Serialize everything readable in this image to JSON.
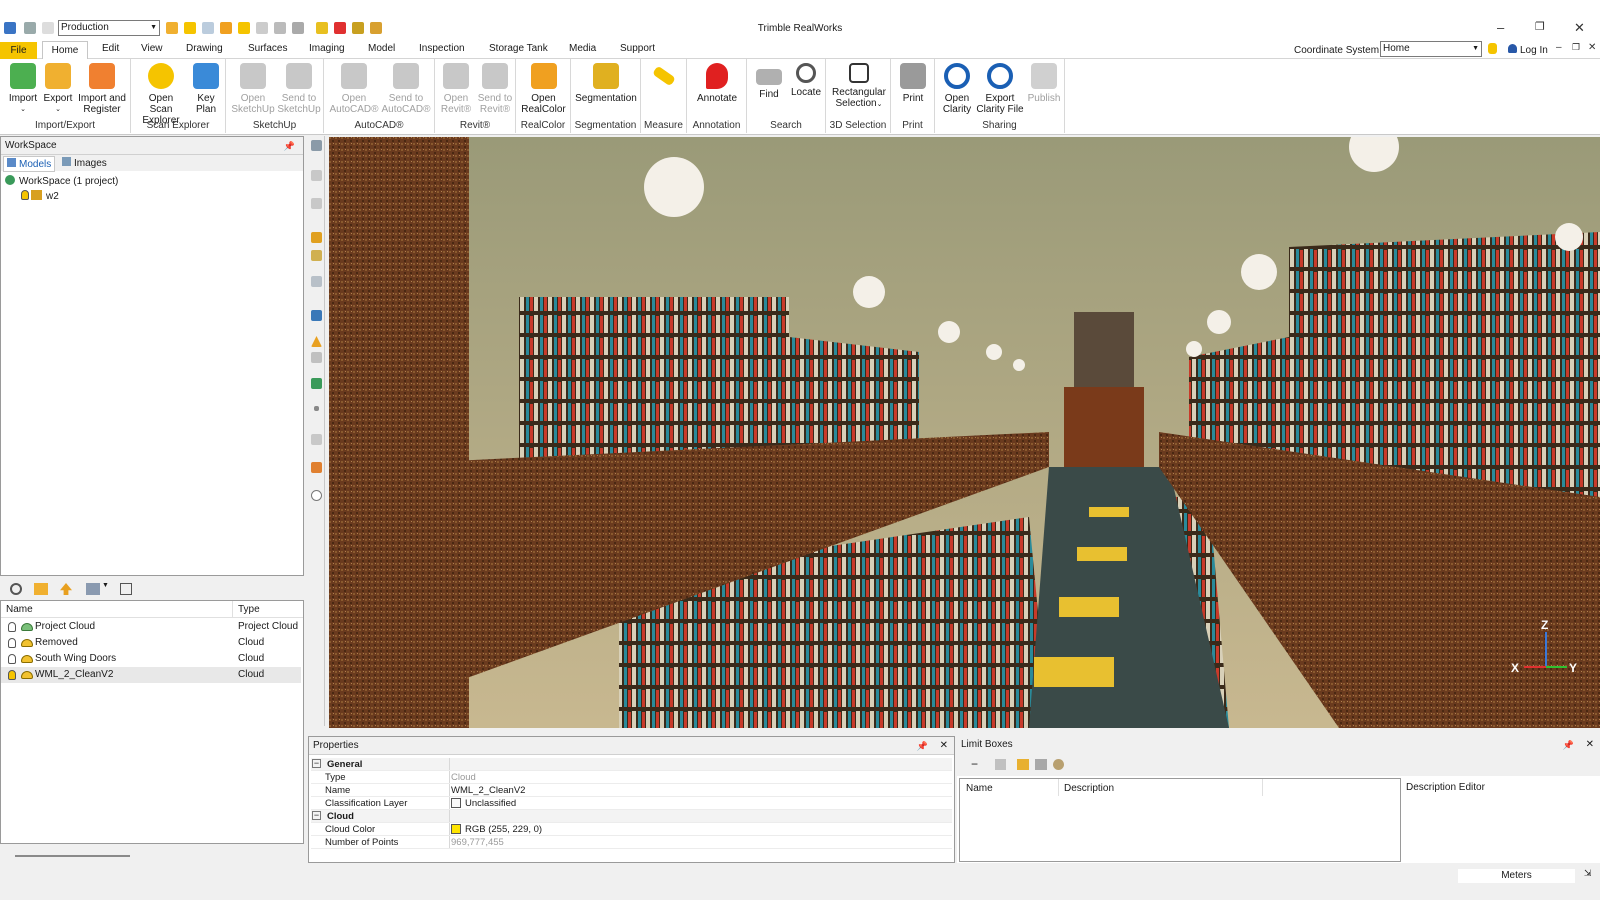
{
  "window": {
    "title": "Trimble RealWorks",
    "profile": "Production"
  },
  "menu": {
    "tabs": [
      "File",
      "Home",
      "Edit",
      "View",
      "Drawing",
      "Surfaces",
      "Imaging",
      "Model",
      "Inspection",
      "Storage Tank",
      "Media",
      "Support"
    ],
    "coordinate_label": "Coordinate System",
    "coordinate_value": "Home",
    "login": "Log In"
  },
  "ribbon": {
    "import_export": {
      "label": "Import/Export",
      "import": "Import",
      "export": "Export",
      "import_register_1": "Import and",
      "import_register_2": "Register"
    },
    "scan_explorer": {
      "label": "Scan Explorer",
      "open_scan_1": "Open Scan",
      "open_scan_2": "Explorer",
      "key_plan_1": "Key",
      "key_plan_2": "Plan"
    },
    "sketchup": {
      "label": "SketchUp",
      "open_1": "Open",
      "open_2": "SketchUp",
      "send_1": "Send to",
      "send_2": "SketchUp"
    },
    "autocad": {
      "label": "AutoCAD®",
      "open_1": "Open",
      "open_2": "AutoCAD®",
      "send_1": "Send to",
      "send_2": "AutoCAD®"
    },
    "revit": {
      "label": "Revit®",
      "open_1": "Open",
      "open_2": "Revit®",
      "send_1": "Send to",
      "send_2": "Revit®"
    },
    "realcolor": {
      "label": "RealColor",
      "open_1": "Open",
      "open_2": "RealColor"
    },
    "segmentation": {
      "label": "Segmentation",
      "btn": "Segmentation"
    },
    "measure": {
      "label": "Measure"
    },
    "annotation": {
      "label": "Annotation",
      "btn": "Annotate"
    },
    "search": {
      "label": "Search",
      "find": "Find",
      "locate": "Locate"
    },
    "selection": {
      "label": "3D Selection",
      "btn_1": "Rectangular",
      "btn_2": "Selection"
    },
    "print": {
      "label": "Print",
      "btn": "Print"
    },
    "sharing": {
      "label": "Sharing",
      "open_1": "Open",
      "open_2": "Clarity",
      "export_1": "Export",
      "export_2": "Clarity File",
      "publish": "Publish"
    }
  },
  "workspace": {
    "title": "WorkSpace",
    "tabs": [
      "Models",
      "Images"
    ],
    "root": "WorkSpace  (1 project)",
    "child": "w2"
  },
  "model_list": {
    "col_name": "Name",
    "col_type": "Type",
    "rows": [
      {
        "name": "Project Cloud",
        "type": "Project Cloud"
      },
      {
        "name": "Removed",
        "type": "Cloud"
      },
      {
        "name": "South Wing Doors",
        "type": "Cloud"
      },
      {
        "name": "WML_2_CleanV2",
        "type": "Cloud"
      }
    ]
  },
  "properties": {
    "title": "Properties",
    "general": "General",
    "type_k": "Type",
    "type_v": "Cloud",
    "name_k": "Name",
    "name_v": "WML_2_CleanV2",
    "class_k": "Classification Layer",
    "class_v": "Unclassified",
    "cloud": "Cloud",
    "color_k": "Cloud Color",
    "color_v": "RGB (255, 229, 0)",
    "points_k": "Number of Points",
    "points_v": "969,777,455"
  },
  "limit_boxes": {
    "title": "Limit Boxes",
    "col_name": "Name",
    "col_desc": "Description",
    "desc_editor": "Description Editor"
  },
  "axes": {
    "z": "Z",
    "x": "X",
    "y": "Y"
  },
  "status": {
    "units": "Meters"
  },
  "colors": {
    "accent": "#f5c400",
    "cloud_yellow": "#ffe500"
  }
}
